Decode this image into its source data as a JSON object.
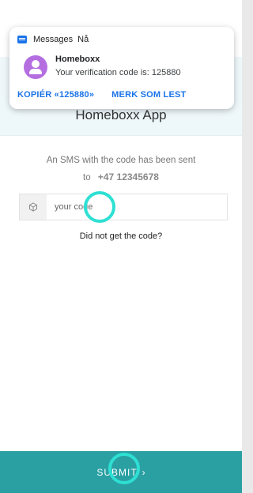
{
  "notification": {
    "app_name": "Messages",
    "time": "Nå",
    "sender": "Homeboxx",
    "preview": "Your verification code is: 125880",
    "actions": [
      "KOPIÉR «125880»",
      "MERK SOM LEST"
    ]
  },
  "app": {
    "title": "Homeboxx App"
  },
  "verification": {
    "info_text": "An SMS with the code has been sent",
    "to_prefix": "to",
    "phone_number": "+47 12345678",
    "code_value": "",
    "code_placeholder": "your code",
    "resend_text": "Did not get the code?"
  },
  "submit": {
    "label": "SUBMIT",
    "arrow": "›"
  },
  "colors": {
    "accent": "#2aa0a3",
    "header_bg": "#eef7fa",
    "touch_indicator": "#2ee0d3",
    "link_blue": "#1a73e8",
    "avatar": "#b46ee0"
  },
  "icons": {
    "notification_app": "messages-icon",
    "sender_avatar": "person-avatar-icon",
    "code_field": "cube-icon",
    "submit": "chevron-right-icon"
  }
}
